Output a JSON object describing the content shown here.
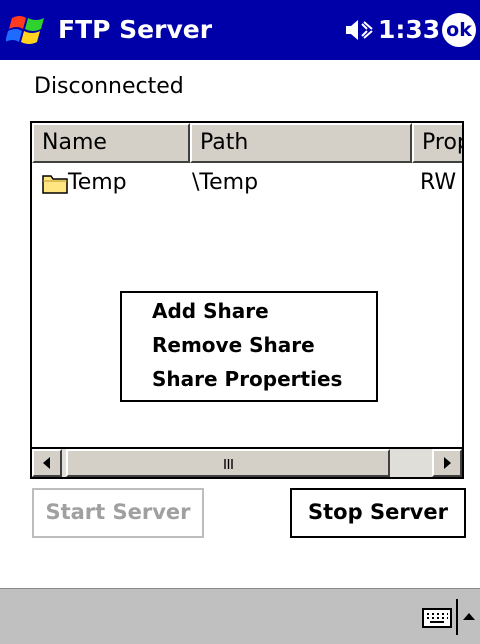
{
  "titlebar": {
    "app_title": "FTP Server",
    "time": "1:33",
    "ok_label": "ok",
    "bg_color": "#0000a8"
  },
  "status": {
    "text": "Disconnected"
  },
  "shares_list": {
    "columns": [
      "Name",
      "Path",
      "Prop"
    ],
    "rows": [
      {
        "name": "Temp",
        "path": "\\Temp",
        "prop": "RW",
        "icon": "folder-icon"
      }
    ]
  },
  "context_menu": {
    "items": [
      "Add Share",
      "Remove Share",
      "Share Properties"
    ]
  },
  "buttons": {
    "start_server": "Start Server",
    "stop_server": "Stop Server"
  },
  "menubar": {
    "icons": [
      "keyboard-icon",
      "sip-arrow-up-icon"
    ]
  }
}
